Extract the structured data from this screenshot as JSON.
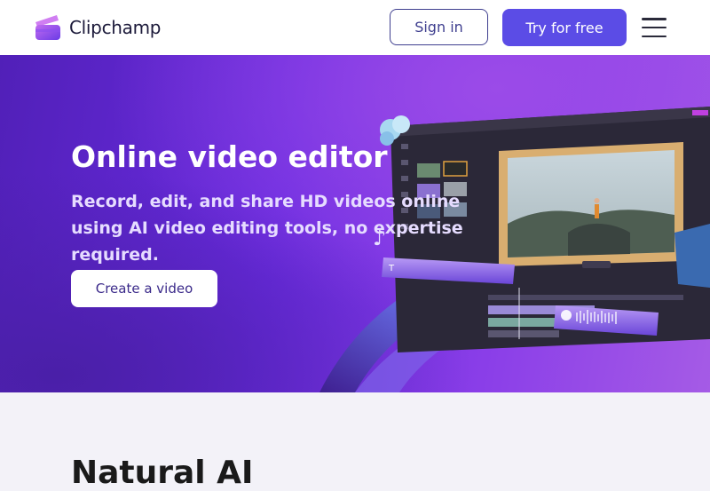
{
  "header": {
    "brand": "Clipchamp",
    "signin_label": "Sign in",
    "try_label": "Try for free",
    "accent_color": "#5b4ce6"
  },
  "hero": {
    "title": "Online video editor",
    "subtitle": "Record, edit, and share HD videos online using AI video editing tools, no expertise required.",
    "cta_label": "Create a video"
  },
  "next_section": {
    "heading": "Natural AI"
  }
}
